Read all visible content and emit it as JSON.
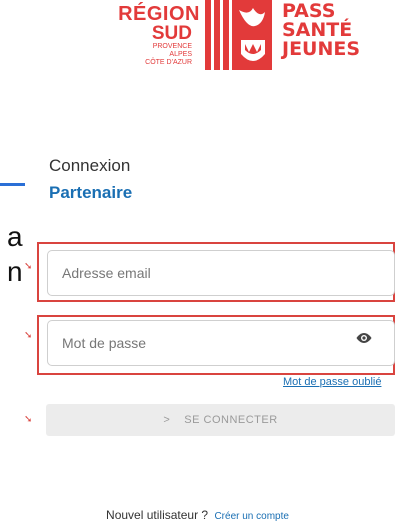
{
  "logo": {
    "region_line1": "RÉGION",
    "region_line2": "SUD",
    "region_line3": "PROVENCE",
    "region_line4": "ALPES",
    "region_line5": "CÔTE D'AZUR",
    "pass_line1": "PASS",
    "pass_line2": "SANTÉ",
    "pass_line3": "JEUNES"
  },
  "edge_fragments": {
    "letter_a": "a",
    "letter_n": "n"
  },
  "login": {
    "title": "Connexion",
    "subtitle": "Partenaire",
    "email_placeholder": "Adresse email",
    "password_placeholder": "Mot de passe",
    "forgot_label": "Mot de passe oublié",
    "submit_label": "SE CONNECTER",
    "submit_chevron": ">",
    "new_user_text": "Nouvel utilisateur ?",
    "create_account_label": "Créer un compte"
  },
  "annotation_arrow": "➘",
  "colors": {
    "brand_red": "#e23a3a",
    "link_blue": "#1a6fb3",
    "annotation_red": "#d9443f",
    "button_bg": "#ececec"
  },
  "icons": {
    "eye": "eye-icon",
    "chevron": "chevron-right-icon",
    "arrow": "annotation-arrow-icon"
  }
}
